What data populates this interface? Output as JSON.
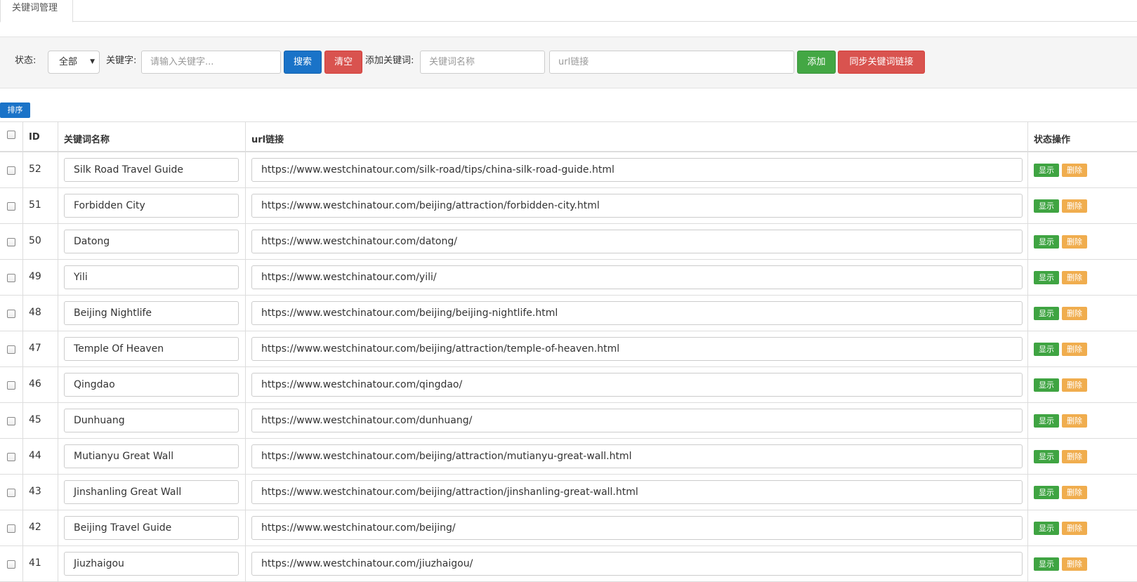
{
  "tabs": [
    {
      "label": "关键词管理"
    }
  ],
  "filter": {
    "status_label": "状态:",
    "status_value": "全部",
    "keyword_label": "关键字:",
    "keyword_placeholder": "请输入关键字...",
    "search_label": "搜索",
    "clear_label": "清空",
    "add_label_text": "添加关键词:",
    "name_placeholder": "关键词名称",
    "url_placeholder": "url链接",
    "add_button": "添加",
    "sync_button": "同步关键词链接"
  },
  "sort_button": "排序",
  "table": {
    "headers": {
      "id": "ID",
      "name": "关键词名称",
      "url": "url链接",
      "op": "状态操作"
    },
    "show_label": "显示",
    "delete_label": "删除",
    "rows": [
      {
        "id": "52",
        "name": "Silk Road Travel Guide",
        "url": "https://www.westchinatour.com/silk-road/tips/china-silk-road-guide.html"
      },
      {
        "id": "51",
        "name": "Forbidden City",
        "url": "https://www.westchinatour.com/beijing/attraction/forbidden-city.html"
      },
      {
        "id": "50",
        "name": "Datong",
        "url": "https://www.westchinatour.com/datong/"
      },
      {
        "id": "49",
        "name": "Yili",
        "url": "https://www.westchinatour.com/yili/"
      },
      {
        "id": "48",
        "name": "Beijing Nightlife",
        "url": "https://www.westchinatour.com/beijing/beijing-nightlife.html"
      },
      {
        "id": "47",
        "name": "Temple Of Heaven",
        "url": "https://www.westchinatour.com/beijing/attraction/temple-of-heaven.html"
      },
      {
        "id": "46",
        "name": "Qingdao",
        "url": "https://www.westchinatour.com/qingdao/"
      },
      {
        "id": "45",
        "name": "Dunhuang",
        "url": "https://www.westchinatour.com/dunhuang/"
      },
      {
        "id": "44",
        "name": "Mutianyu Great Wall",
        "url": "https://www.westchinatour.com/beijing/attraction/mutianyu-great-wall.html"
      },
      {
        "id": "43",
        "name": "Jinshanling Great Wall",
        "url": "https://www.westchinatour.com/beijing/attraction/jinshanling-great-wall.html"
      },
      {
        "id": "42",
        "name": "Beijing Travel Guide",
        "url": "https://www.westchinatour.com/beijing/"
      },
      {
        "id": "41",
        "name": "Jiuzhaigou",
        "url": "https://www.westchinatour.com/jiuzhaigou/"
      }
    ]
  }
}
